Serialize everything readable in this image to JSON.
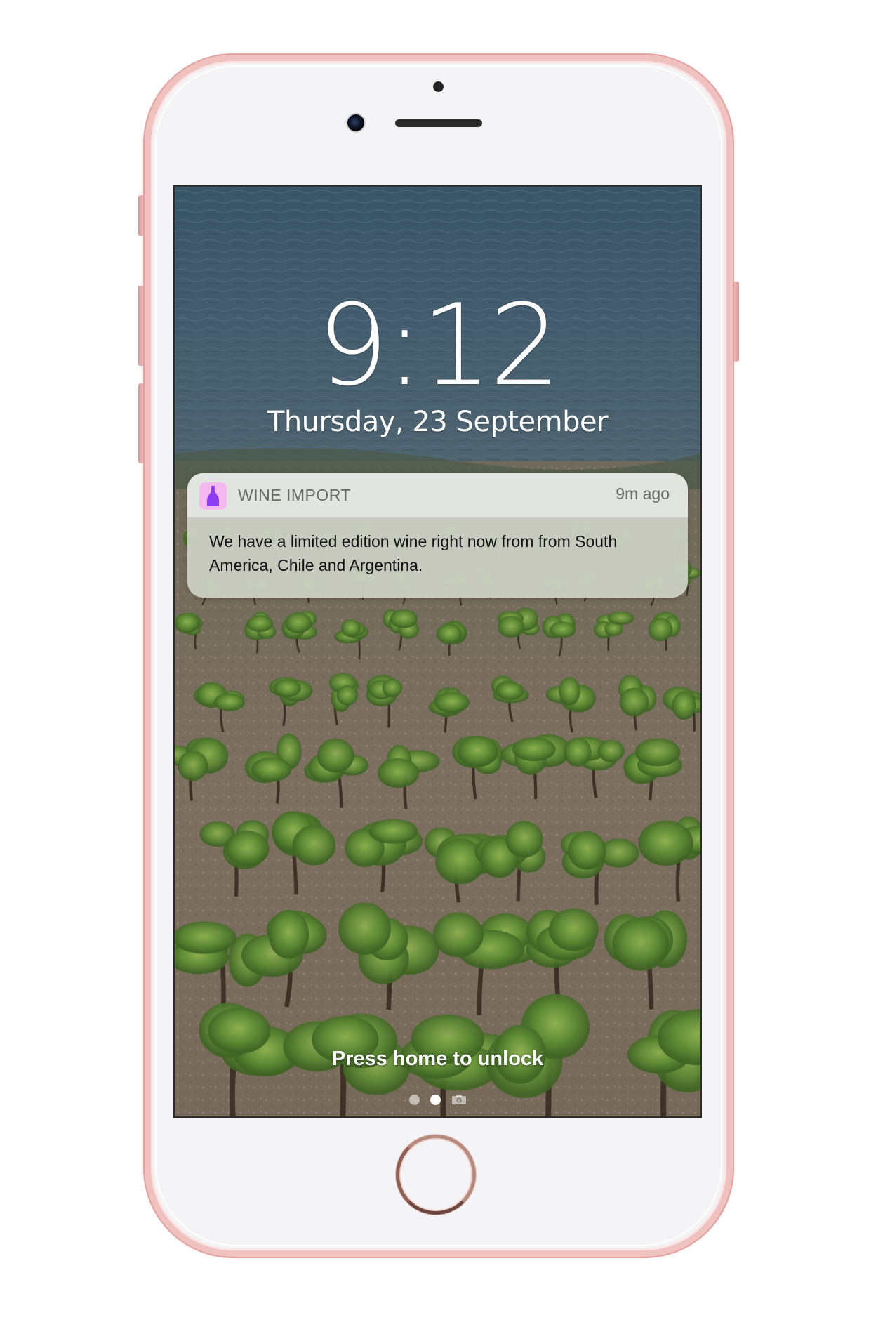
{
  "lock_screen": {
    "time": "9:12",
    "date": "Thursday, 23 September",
    "unlock_hint": "Press home to unlock",
    "page_indicator": {
      "pages": 3,
      "active_index": 1,
      "last_item_icon": "camera-icon"
    }
  },
  "notification": {
    "app_icon": "wine-bottle-icon",
    "app_name": "WINE IMPORT",
    "time_ago": "9m ago",
    "message": "We have a limited edition wine right now from from South America, Chile and Argentina."
  },
  "colors": {
    "phone_frame": "#efc2c0",
    "app_icon_background": "#f5b7ef",
    "app_icon_glyph": "#8b3df0"
  }
}
